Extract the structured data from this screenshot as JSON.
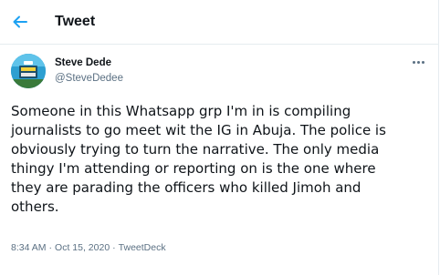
{
  "header": {
    "title": "Tweet",
    "back_icon": "arrow-left-icon",
    "accent_color": "#1da1f2"
  },
  "tweet": {
    "author_name": "Steve Dede",
    "author_handle": "@SteveDedee",
    "more_icon": "more-options-icon",
    "text": "Someone in this Whatsapp grp I'm in is compiling\njournalists to go meet wit the IG in Abuja. The police is\nobviously trying to turn the narrative.  The only  media\nthingy I'm attending or reporting on is the one where\nthey are parading the officers who killed Jimoh and\nothers.",
    "time": "8:34 AM",
    "separator": "·",
    "date": "Oct 15, 2020",
    "source": "TweetDeck"
  }
}
